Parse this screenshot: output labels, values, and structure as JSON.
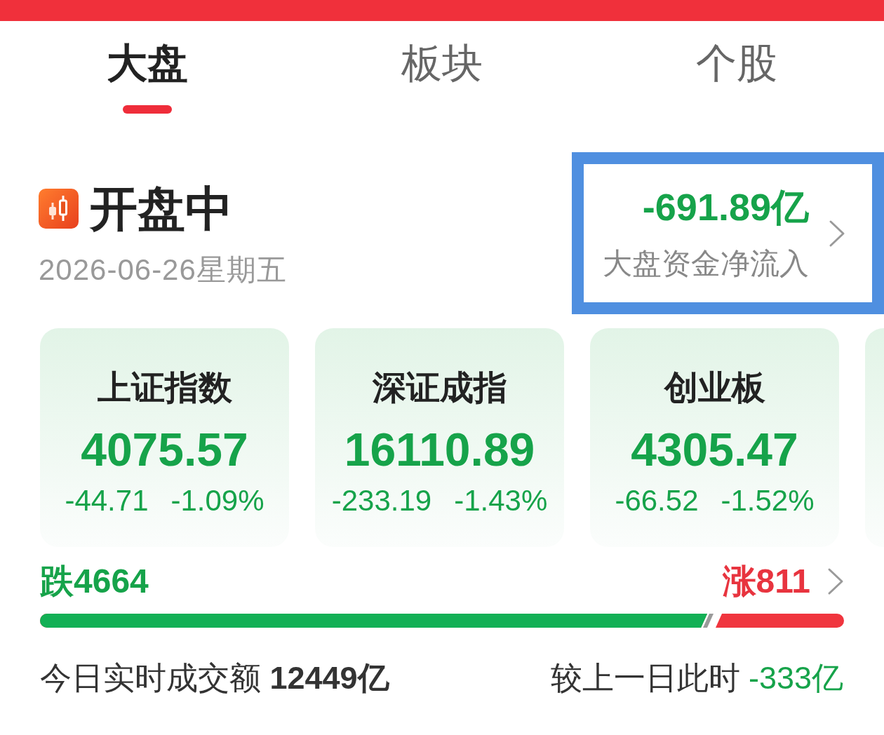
{
  "tabs": [
    {
      "label": "大盘",
      "selected": true
    },
    {
      "label": "板块",
      "selected": false
    },
    {
      "label": "个股",
      "selected": false
    }
  ],
  "market_status": {
    "label": "开盘中",
    "date": "2026-06-26星期五"
  },
  "net_inflow": {
    "value": "-691.89亿",
    "label": "大盘资金净流入",
    "highlighted": true
  },
  "indices": [
    {
      "name": "上证指数",
      "value": "4075.57",
      "change": "-44.71",
      "change_percent": "-1.09%"
    },
    {
      "name": "深证成指",
      "value": "16110.89",
      "change": "-233.19",
      "change_percent": "-1.43%"
    },
    {
      "name": "创业板",
      "value": "4305.47",
      "change": "-66.52",
      "change_percent": "-1.52%"
    }
  ],
  "breadth": {
    "falling": "跌4664",
    "rising": "涨811",
    "level": 0.83
  },
  "turnover": {
    "text": "今日实时成交额 **12449亿**",
    "comparison_label": "较上一日此时",
    "comparison_value": "-333亿"
  }
}
